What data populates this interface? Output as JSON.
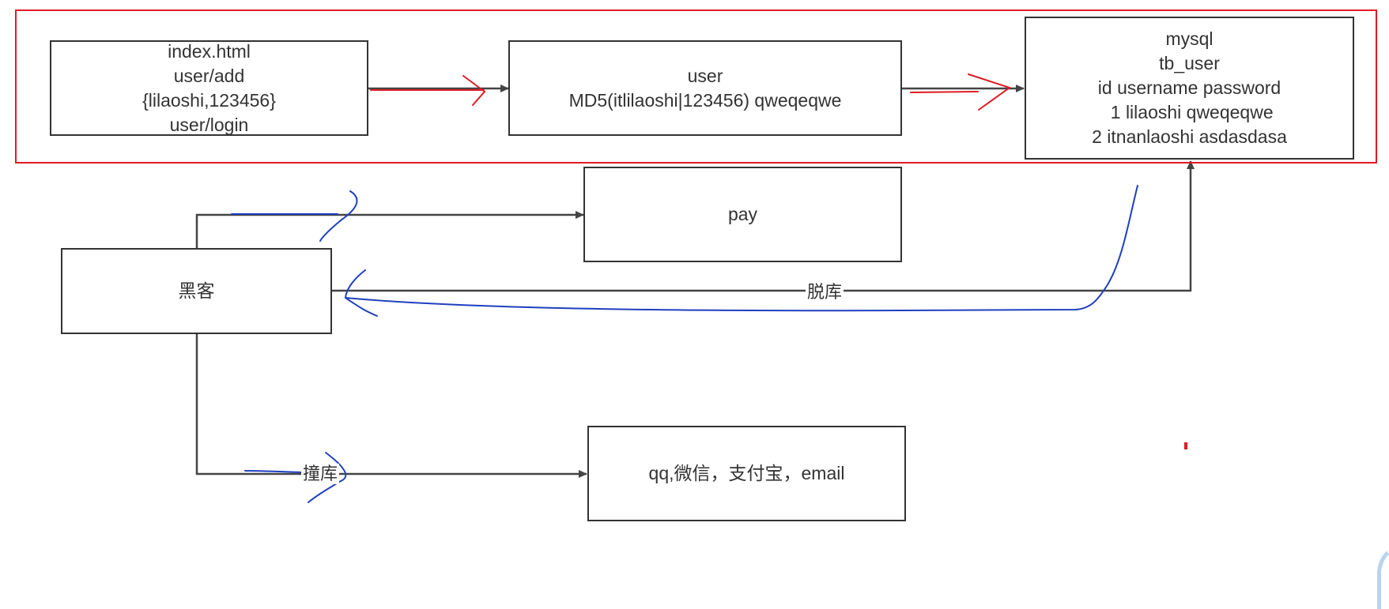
{
  "diagram": {
    "nodes": {
      "client": {
        "lines": [
          "index.html",
          "user/add",
          "{lilaoshi,123456}",
          "user/login"
        ]
      },
      "user_service": {
        "lines": [
          "user",
          "MD5(itlilaoshi|123456) qweqeqwe"
        ]
      },
      "mysql": {
        "lines": [
          "mysql",
          "tb_user",
          "id username password",
          " 1 lilaoshi qweqeqwe",
          "2 itnanlaoshi asdasdasa"
        ]
      },
      "pay": {
        "lines": [
          "pay"
        ]
      },
      "hacker": {
        "lines": [
          "黑客"
        ]
      },
      "targets": {
        "lines": [
          "qq,微信，支付宝，email"
        ]
      }
    },
    "edges": {
      "drag_db_label": "脱库",
      "credential_stuffing_label": "撞库"
    }
  },
  "colors": {
    "node_border": "#333333",
    "arrow": "#444444",
    "highlight_box": "#e01b24",
    "red_annotation": "#e01b24",
    "blue_annotation": "#1f3fbf"
  }
}
